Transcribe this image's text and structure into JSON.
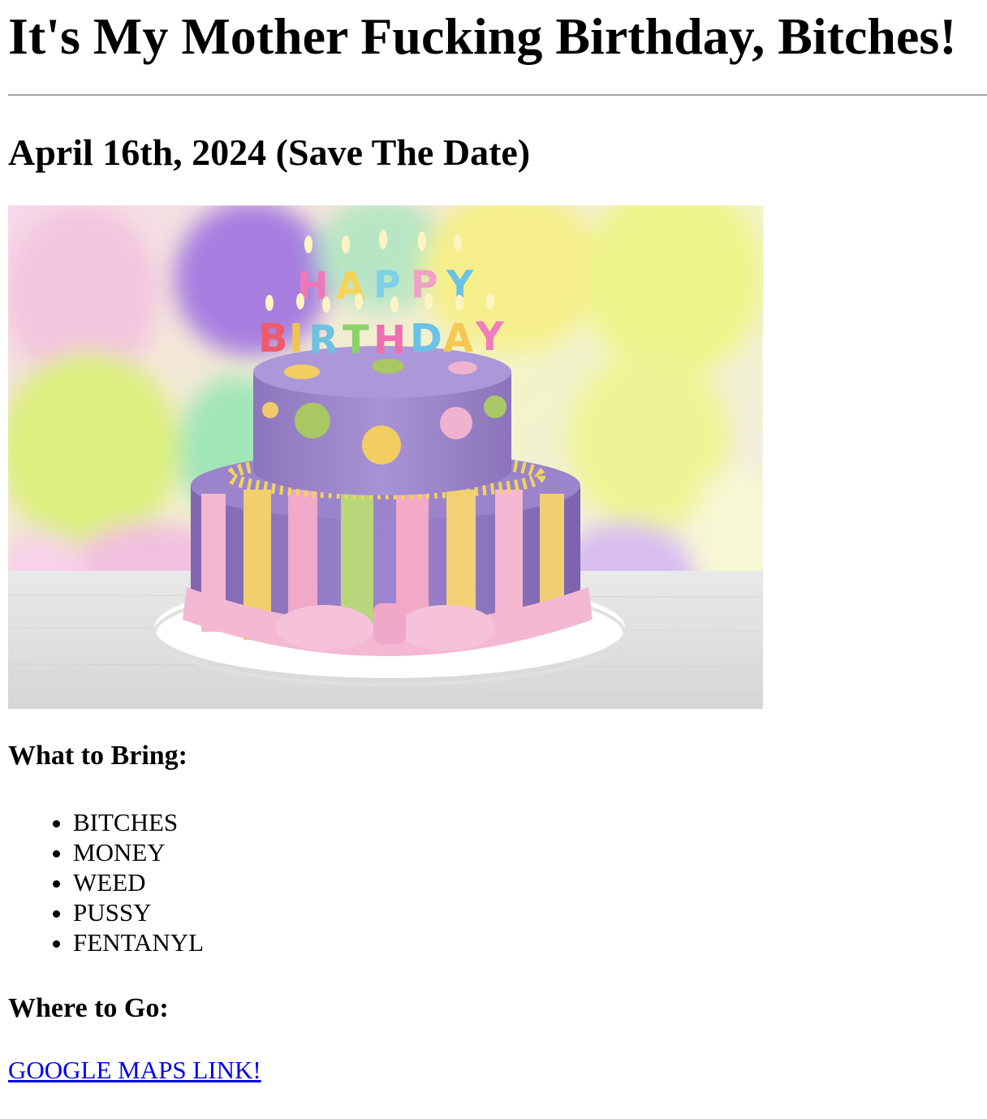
{
  "page": {
    "title": "It's My Mother Fucking Birthday, Bitches!",
    "date_line": "April 16th, 2024 (Save The Date)",
    "bring": {
      "heading": "What to Bring:",
      "items": [
        "BITCHES",
        "MONEY",
        "WEED",
        "PUSSY",
        "FENTANYL"
      ]
    },
    "where": {
      "heading": "Where to Go:",
      "link_text": "GOOGLE MAPS LINK!"
    }
  },
  "image": {
    "candle_letters_top": [
      "H",
      "A",
      "P",
      "P",
      "Y"
    ],
    "candle_letters_bottom": [
      "B",
      "I",
      "R",
      "T",
      "H",
      "D",
      "A",
      "Y"
    ]
  },
  "colors": {
    "link": "#0000ee",
    "rule": "#a3a3a3"
  }
}
